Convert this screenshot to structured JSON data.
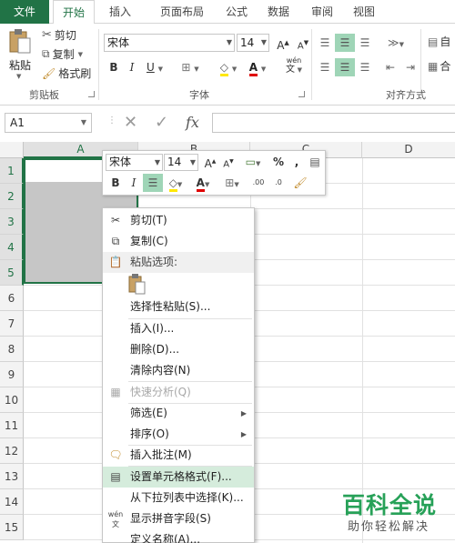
{
  "tabs": [
    "文件",
    "开始",
    "插入",
    "页面布局",
    "公式",
    "数据",
    "审阅",
    "视图"
  ],
  "ribbon": {
    "paste_label": "粘贴",
    "cut_label": "剪切",
    "copy_label": "复制",
    "format_painter_label": "格式刷",
    "clipboard_group": "剪贴板",
    "font_name": "宋体",
    "font_size": "14",
    "bold": "B",
    "italic": "I",
    "underline": "U",
    "grow_font": "A",
    "shrink_font": "A",
    "font_color_glyph": "A",
    "phonetic_glyph": "wén",
    "font_group": "字体",
    "align_group": "对齐方式",
    "wrap_text_partial": "自",
    "merge_partial": "合"
  },
  "formula_bar": {
    "name_box": "A1",
    "fx": "fx"
  },
  "columns": [
    "A",
    "B",
    "C",
    "D"
  ],
  "rows": [
    "1",
    "2",
    "3",
    "4",
    "5",
    "6",
    "7",
    "8",
    "9",
    "10",
    "11",
    "12",
    "13",
    "14",
    "15"
  ],
  "mini_toolbar": {
    "font_name": "宋体",
    "font_size": "14",
    "bold": "B",
    "italic": "I",
    "percent": "%",
    "comma": ",",
    "inc_decimal": ".00",
    "dec_decimal": ".0"
  },
  "context_menu": {
    "cut": "剪切(T)",
    "copy": "复制(C)",
    "paste_options": "粘贴选项:",
    "paste_special": "选择性粘贴(S)...",
    "insert": "插入(I)...",
    "delete": "删除(D)...",
    "clear_contents": "清除内容(N)",
    "quick_analysis": "快速分析(Q)",
    "filter": "筛选(E)",
    "sort": "排序(O)",
    "insert_comment": "插入批注(M)",
    "format_cells": "设置单元格格式(F)...",
    "pick_from_list": "从下拉列表中选择(K)...",
    "show_phonetic": "显示拼音字段(S)",
    "define_name": "定义名称(A)..."
  },
  "watermark": {
    "title": "百科全说",
    "subtitle": "助你轻松解决"
  },
  "colors": {
    "accent": "#217346",
    "selection_fill": "#c6c6c6",
    "menu_hover": "#d5ecdc",
    "watermark": "#27a158"
  }
}
